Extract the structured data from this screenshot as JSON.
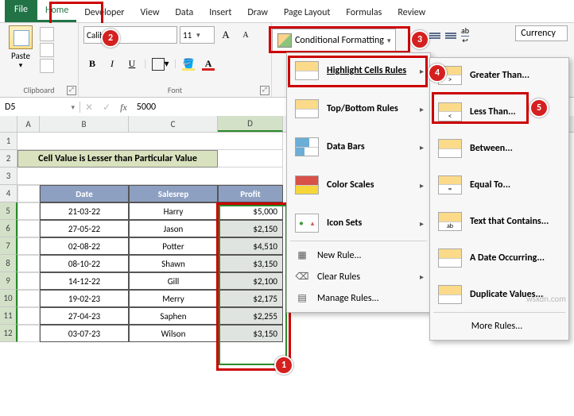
{
  "ribbon": {
    "tabs": [
      "File",
      "Home",
      "Developer",
      "View",
      "Data",
      "Insert",
      "Draw",
      "Page Layout",
      "Formulas",
      "Review"
    ],
    "active_tab": "Home",
    "clipboard": {
      "paste_label": "Paste",
      "group_label": "Clipboard"
    },
    "font": {
      "name": "Calibri",
      "size": "11",
      "group_label": "Font",
      "buttons": {
        "bold": "B",
        "italic": "I",
        "underline": "U",
        "increase": "A",
        "decrease": "A"
      }
    },
    "conditional_formatting_label": "Conditional Formatting",
    "number_format": "Currency",
    "wrap_text_label": "ab"
  },
  "formula_bar": {
    "name_box": "D5",
    "fx": "fx",
    "value": "5000"
  },
  "grid": {
    "columns": [
      "",
      "A",
      "B",
      "C",
      "D"
    ],
    "title": "Cell Value is Lesser than Particular Value",
    "headers": [
      "Date",
      "Salesrep",
      "Profit"
    ],
    "rows": [
      {
        "n": 5,
        "date": "21-03-22",
        "rep": "Harry",
        "profit": "$5,000"
      },
      {
        "n": 6,
        "date": "27-05-22",
        "rep": "Jason",
        "profit": "$2,150"
      },
      {
        "n": 7,
        "date": "02-08-22",
        "rep": "Potter",
        "profit": "$4,510"
      },
      {
        "n": 8,
        "date": "08-10-22",
        "rep": "Shawn",
        "profit": "$3,150"
      },
      {
        "n": 9,
        "date": "14-12-22",
        "rep": "Gill",
        "profit": "$2,100"
      },
      {
        "n": 10,
        "date": "19-02-23",
        "rep": "Merry",
        "profit": "$2,175"
      },
      {
        "n": 11,
        "date": "27-04-23",
        "rep": "Saphen",
        "profit": "$2,255"
      },
      {
        "n": 12,
        "date": "03-07-23",
        "rep": "Wilson",
        "profit": "$3,150"
      }
    ]
  },
  "cf_menu": {
    "items": [
      {
        "label": "Highlight Cells Rules",
        "sub": true
      },
      {
        "label": "Top/Bottom Rules",
        "sub": true
      },
      {
        "label": "Data Bars",
        "sub": true
      },
      {
        "label": "Color Scales",
        "sub": true
      },
      {
        "label": "Icon Sets",
        "sub": true
      }
    ],
    "plain": [
      {
        "label": "New Rule..."
      },
      {
        "label": "Clear Rules",
        "sub": true
      },
      {
        "label": "Manage Rules..."
      }
    ]
  },
  "hcr_menu": {
    "items": [
      "Greater Than...",
      "Less Than...",
      "Between...",
      "Equal To...",
      "Text that Contains...",
      "A Date Occurring...",
      "Duplicate Values..."
    ],
    "more": "More Rules..."
  },
  "callouts": {
    "c1": "1",
    "c2": "2",
    "c3": "3",
    "c4": "4",
    "c5": "5"
  },
  "watermark": "wsxdn.com"
}
